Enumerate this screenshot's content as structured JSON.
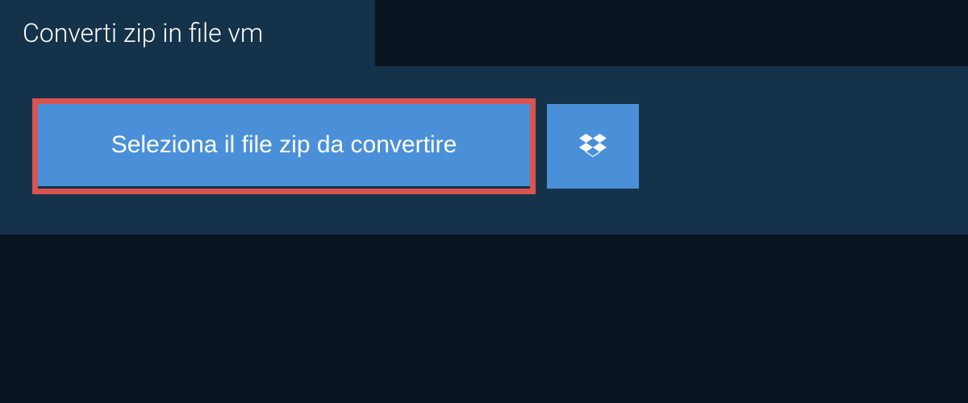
{
  "header": {
    "title": "Converti zip in file vm"
  },
  "actions": {
    "select_file_label": "Seleziona il file zip da convertire"
  },
  "colors": {
    "background_dark": "#081521",
    "panel_blue": "#14334a",
    "button_blue": "#4a90d9",
    "highlight_red": "#d9534f",
    "text_white": "#ffffff"
  }
}
